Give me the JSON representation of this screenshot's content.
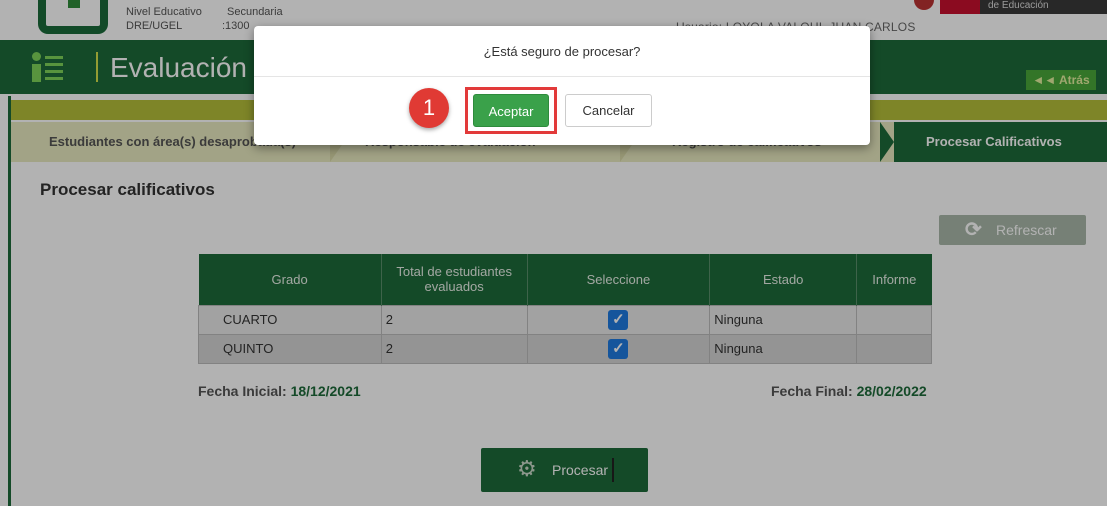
{
  "header": {
    "nivel_label": "Nivel Educativo",
    "nivel_value": "Secundaria",
    "dre_label": "DRE/UGEL",
    "dre_value": ":1300",
    "usuario_text": "Usuario: LOYOLA VALQUI, JUAN CARLOS",
    "ministry_text": "de Educación"
  },
  "band": {
    "title": "Evaluación :",
    "back_label": "◄◄ Atrás"
  },
  "steps": [
    {
      "label": "Estudiantes con área(s) desaprobada(s)"
    },
    {
      "label": "Responsable de evaluación"
    },
    {
      "label": "Registro de calificativos"
    },
    {
      "label": "Procesar Calificativos",
      "active": true
    }
  ],
  "main": {
    "section_title": "Procesar calificativos",
    "refresh_label": "Refrescar",
    "refresh_icon": "refresh-icon",
    "table": {
      "headers": [
        "Grado",
        "Total de estudiantes evaluados",
        "Seleccione",
        "Estado",
        "Informe"
      ],
      "rows": [
        {
          "grado": "CUARTO",
          "total": "2",
          "seleccione": true,
          "estado": "Ninguna",
          "informe": ""
        },
        {
          "grado": "QUINTO",
          "total": "2",
          "seleccione": true,
          "estado": "Ninguna",
          "informe": ""
        }
      ]
    },
    "fecha_inicial_label": "Fecha Inicial:",
    "fecha_inicial_value": "18/12/2021",
    "fecha_final_label": "Fecha Final:",
    "fecha_final_value": "28/02/2022",
    "procesar_label": "Procesar",
    "procesar_icon": "gears-icon"
  },
  "modal": {
    "title": "¿Está seguro de procesar?",
    "ok_label": "Aceptar",
    "cancel_label": "Cancelar",
    "step_badge": "1"
  },
  "colors": {
    "primary_green": "#1e6b3a",
    "accept_green": "#3aa14a",
    "highlight_red": "#e23a3a",
    "checkbox_blue": "#1f7ae0"
  }
}
